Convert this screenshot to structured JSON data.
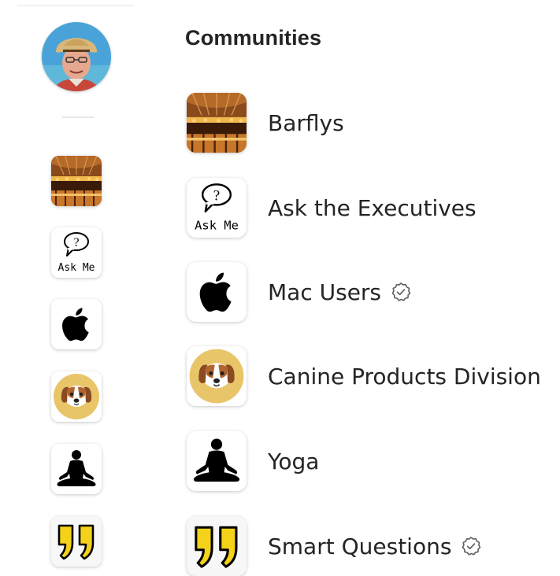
{
  "header": {
    "title": "Communities"
  },
  "user": {
    "avatar_icon": "user-avatar-photo"
  },
  "communities": [
    {
      "name": "Barflys",
      "icon": "bar-interior-photo",
      "verified": false
    },
    {
      "name": "Ask the Executives",
      "icon": "ask-me-speech-bubble",
      "icon_text": "Ask Me",
      "verified": false
    },
    {
      "name": "Mac Users",
      "icon": "apple-logo",
      "verified": true
    },
    {
      "name": "Canine Products Division",
      "icon": "dog-face",
      "verified": false
    },
    {
      "name": "Yoga",
      "icon": "meditation-figure",
      "verified": false
    },
    {
      "name": "Smart Questions",
      "icon": "yellow-quote-marks",
      "verified": true
    }
  ],
  "colors": {
    "text": "#242424",
    "dog_bg": "#e9c56a",
    "quote_yellow": "#f5d21a",
    "verified_gray": "#616161"
  }
}
